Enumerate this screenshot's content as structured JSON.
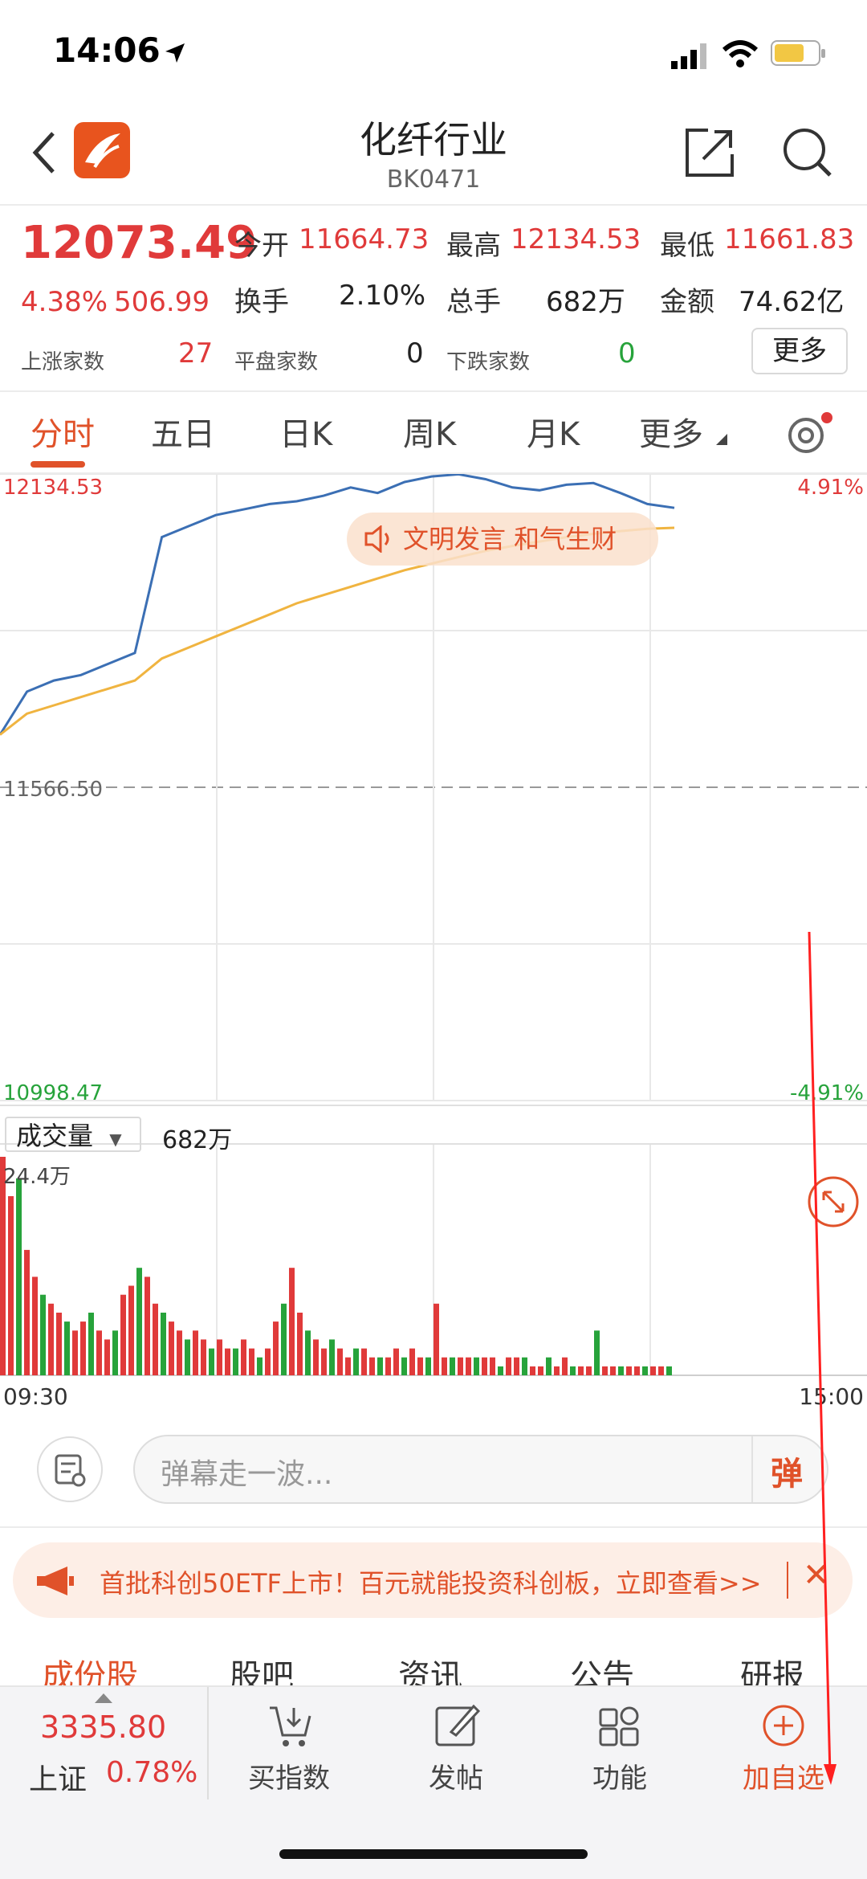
{
  "status_bar": {
    "time": "14:06"
  },
  "header": {
    "title": "化纤行业",
    "code": "BK0471"
  },
  "quote": {
    "price": "12073.49",
    "change_pct": "4.38%",
    "change_abs": "506.99",
    "open_label": "今开",
    "open": "11664.73",
    "high_label": "最高",
    "high": "12134.53",
    "low_label": "最低",
    "low": "11661.83",
    "turnover_label": "换手",
    "turnover": "2.10%",
    "volume_label": "总手",
    "volume": "682万",
    "amount_label": "金额",
    "amount": "74.62亿",
    "up_label": "上涨家数",
    "up_count": "27",
    "flat_label": "平盘家数",
    "flat_count": "0",
    "down_label": "下跌家数",
    "down_count": "0",
    "more_label": "更多"
  },
  "chart_tabs": [
    "分时",
    "五日",
    "日K",
    "周K",
    "月K",
    "更多"
  ],
  "chart": {
    "price_top": "12134.53",
    "pct_top": "4.91%",
    "price_mid": "11566.50",
    "price_bottom": "10998.47",
    "pct_bottom": "-4.91%",
    "notice": "文明发言 和气生财",
    "volume_selector": "成交量",
    "volume_total": "682万",
    "volume_max": "24.4万",
    "time_start": "09:30",
    "time_end": "15:00"
  },
  "chart_data": [
    {
      "type": "line",
      "title": "",
      "ylim": [
        10998.47,
        12134.53
      ],
      "x_range": [
        "09:30",
        "15:00"
      ],
      "series": [
        {
          "values": [
            11661.8,
            11740,
            11760,
            11770,
            11790,
            11810,
            12020,
            12040,
            12060,
            12070,
            12080,
            12085,
            12095,
            12110,
            12100,
            12120,
            12130,
            12134,
            12125,
            12110,
            12105,
            12115,
            12118,
            12100,
            12080,
            12073
          ]
        },
        {
          "values": [
            11661.8,
            11700,
            11715,
            11730,
            11745,
            11760,
            11800,
            11820,
            11840,
            11860,
            11880,
            11900,
            11915,
            11930,
            11945,
            11960,
            11972,
            11984,
            11995,
            12004,
            12012,
            12020,
            12026,
            12031,
            12035,
            12037
          ]
        }
      ],
      "color_price": "#3b6fb4",
      "color_avg": "#f0b440",
      "grid": true
    },
    {
      "type": "bar",
      "title": "",
      "ylim": [
        0,
        24.4
      ],
      "values": [
        24.4,
        20,
        22,
        14,
        11,
        9,
        8,
        7,
        6,
        5,
        6,
        7,
        5,
        4,
        5,
        9,
        10,
        12,
        11,
        8,
        7,
        6,
        5,
        4,
        5,
        4,
        3,
        4,
        3,
        3,
        4,
        3,
        2,
        3,
        6,
        8,
        12,
        7,
        5,
        4,
        3,
        4,
        3,
        2,
        3,
        3,
        2,
        2,
        2,
        3,
        2,
        3,
        2,
        2,
        8,
        2,
        2,
        2,
        2,
        2,
        2,
        2,
        1,
        2,
        2,
        2,
        1,
        1,
        2,
        1,
        2,
        1,
        1,
        1,
        5,
        1,
        1,
        1,
        1,
        1,
        1,
        1,
        1,
        1
      ],
      "up_color": "#e03a3a",
      "down_color": "#27a33b"
    }
  ],
  "comment": {
    "placeholder": "弹幕走一波...",
    "danmu_label": "弹"
  },
  "banner": {
    "text": "首批科创50ETF上市！百元就能投资科创板，立即查看>>"
  },
  "sub_tabs": [
    "成份股",
    "股吧",
    "资讯",
    "公告",
    "研报"
  ],
  "bottom_bar": {
    "index_value": "3335.80",
    "index_name": "上证",
    "index_change": "0.78%",
    "buy_index": "买指数",
    "post": "发帖",
    "functions": "功能",
    "add_watch": "加自选"
  },
  "colors": {
    "accent": "#e0522a",
    "up": "#e03a3a",
    "down": "#27a33b"
  }
}
